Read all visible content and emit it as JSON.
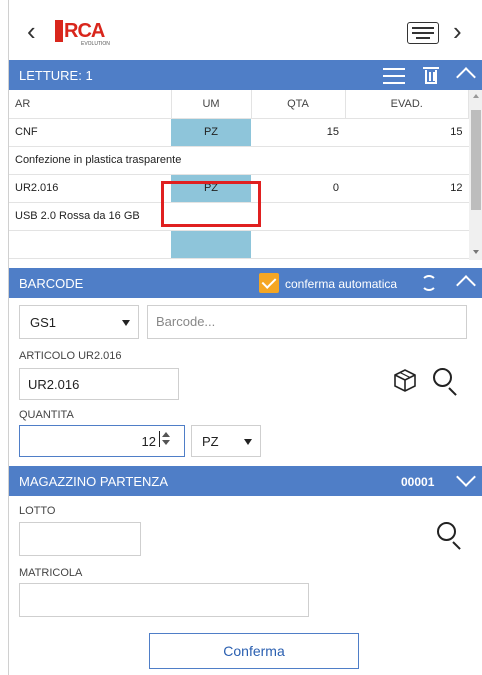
{
  "topbar": {
    "back_icon": "chevron-left-icon",
    "logo_text": "RCA",
    "logo_sub": "EVOLUTION",
    "keyboard_icon": "keyboard-icon",
    "forward_icon": "chevron-right-icon"
  },
  "letture": {
    "title": "LETTURE: 1",
    "columns": [
      "AR",
      "UM",
      "QTA",
      "EVAD."
    ],
    "rows": [
      {
        "ar": "CNF",
        "um": "PZ",
        "qta": "15",
        "evad": "15",
        "desc": "Confezione in plastica trasparente"
      },
      {
        "ar": "UR2.016",
        "um": "PZ",
        "qta": "0",
        "evad": "12",
        "desc": "USB 2.0 Rossa da 16 GB"
      }
    ]
  },
  "barcode": {
    "title": "BARCODE",
    "auto_confirm_label": "conferma automatica",
    "type_value": "GS1",
    "barcode_placeholder": "Barcode...",
    "articolo_label": "ARTICOLO  UR2.016",
    "articolo_value": "UR2.016",
    "quantita_label": "QUANTITA",
    "quantita_value": "12",
    "um_value": "PZ"
  },
  "magazzino": {
    "title": "MAGAZZINO PARTENZA",
    "code": "00001",
    "lotto_label": "LOTTO",
    "matricola_label": "MATRICOLA"
  },
  "actions": {
    "confirm_label": "Conferma"
  },
  "colors": {
    "header_bg": "#4f7ec7",
    "um_cell_bg": "#8ec5da",
    "checkbox": "#f5a623",
    "highlight": "#e02020"
  }
}
